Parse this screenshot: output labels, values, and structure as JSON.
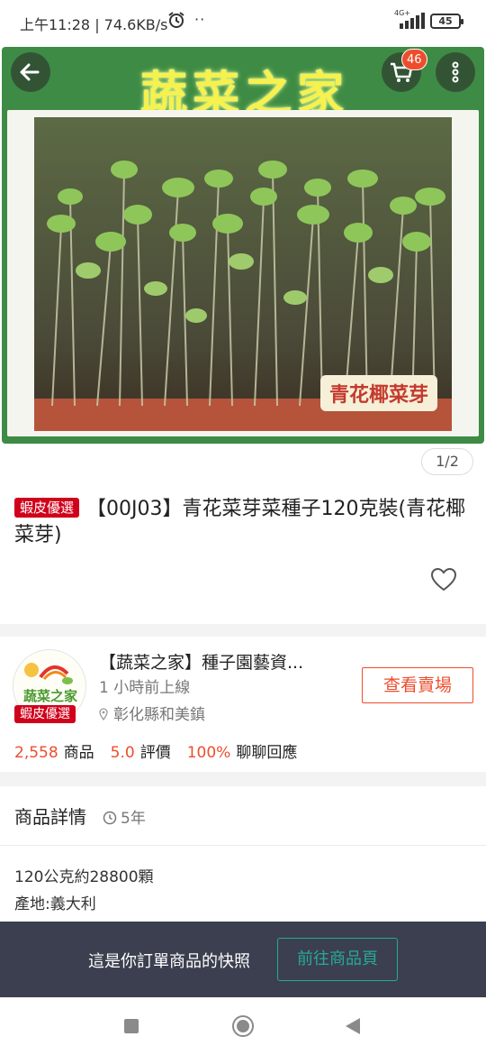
{
  "status_bar": {
    "time_speed": "上午11:28 | 74.6KB/s",
    "dots": "··",
    "network": "4G+",
    "battery": "45"
  },
  "hero": {
    "brand_text": "蔬菜之家",
    "caption": "青花椰菜芽",
    "cart_count": "46",
    "image_counter": "1/2"
  },
  "product": {
    "mall_tag": "蝦皮優選",
    "title": "【00J03】青花菜芽菜種子120克裝(青花椰菜芽)"
  },
  "shop": {
    "name": "【蔬菜之家】種子園藝資...",
    "online": "1 小時前上線",
    "location": "彰化縣和美鎮",
    "avatar_tag": "蝦皮優選",
    "avatar_text": "蔬菜之家",
    "view_button": "查看賣場",
    "stats": {
      "products_num": "2,558",
      "products_label": "商品",
      "rating_num": "5.0",
      "rating_label": "評價",
      "response_num": "100%",
      "response_label": "聊聊回應"
    }
  },
  "details": {
    "label": "商品詳情",
    "age": "5年",
    "lines": [
      "120公克約28800顆",
      "產地:義大利"
    ]
  },
  "snapshot": {
    "message": "這是你訂單商品的快照",
    "button": "前往商品頁"
  },
  "colors": {
    "brand_orange": "#ee4d2d",
    "mall_red": "#d0011b",
    "banner_green": "#3e8b45",
    "snapshot_bg": "#3b3f4f",
    "teal": "#26aa99"
  },
  "icons": [
    "back-arrow-icon",
    "cart-icon",
    "more-vertical-icon",
    "heart-icon",
    "location-pin-icon",
    "clock-icon",
    "alarm-icon",
    "signal-icon",
    "battery-icon"
  ]
}
